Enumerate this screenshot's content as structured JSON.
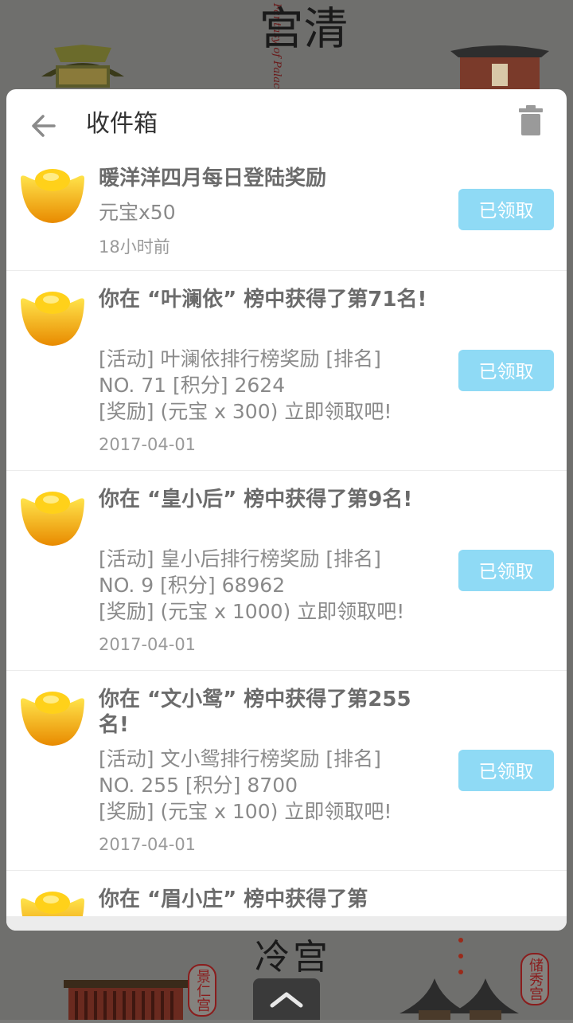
{
  "background": {
    "title_glyphs": "清宫",
    "subtitle": "Fantasy of Palace",
    "bottom_sign": "冷宫",
    "seal_left": "景仁宫",
    "seal_right": "储秀宫"
  },
  "inbox": {
    "title": "收件箱",
    "back_icon": "arrow-left-icon",
    "delete_icon": "trash-icon"
  },
  "messages": [
    {
      "title": "暖洋洋四月每日登陆奖励",
      "body": [
        "元宝x50"
      ],
      "time": "18小时前",
      "button": "已领取",
      "icon": "gold-ingot-icon"
    },
    {
      "title": "你在 “叶澜依” 榜中获得了第71名!",
      "body": [
        "[活动] 叶澜依排行榜奖励 [排名]",
        "NO. 71 [积分] 2624",
        "[奖励] (元宝 x 300) 立即领取吧!"
      ],
      "time": "2017-04-01",
      "button": "已领取",
      "icon": "gold-ingot-icon"
    },
    {
      "title": "你在 “皇小后” 榜中获得了第9名!",
      "body": [
        "[活动] 皇小后排行榜奖励 [排名]",
        "NO. 9 [积分] 68962",
        "[奖励] (元宝 x 1000) 立即领取吧!"
      ],
      "time": "2017-04-01",
      "button": "已领取",
      "icon": "gold-ingot-icon"
    },
    {
      "title": "你在 “文小鸳” 榜中获得了第255名!",
      "body": [
        "[活动] 文小鸳排行榜奖励 [排名]",
        "NO. 255 [积分] 8700",
        "[奖励] (元宝 x 100) 立即领取吧!"
      ],
      "time": "2017-04-01",
      "button": "已领取",
      "icon": "gold-ingot-icon"
    },
    {
      "title": "你在 “眉小庄” 榜中获得了第",
      "body": [],
      "time": "",
      "button": "",
      "icon": "gold-ingot-icon"
    }
  ],
  "colors": {
    "claim_button": "#8fdaf5",
    "ingot_gold": "#f5b800"
  },
  "bottom_handle_icon": "chevron-up-icon"
}
